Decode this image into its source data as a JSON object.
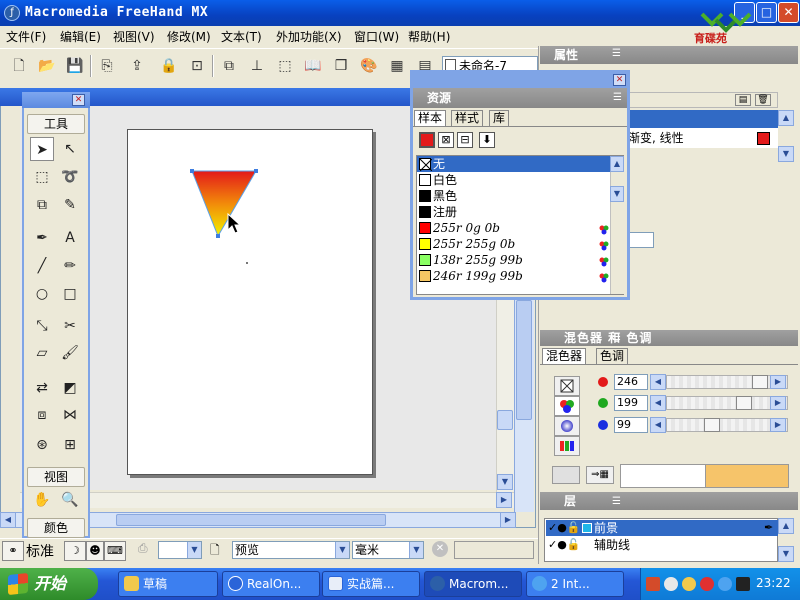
{
  "window": {
    "title": "Macromedia FreeHand MX",
    "minimize": "_",
    "maximize": "□",
    "close": "✕"
  },
  "logo": {
    "text": "育碟苑"
  },
  "menu": [
    "文件(F)",
    "编辑(E)",
    "视图(V)",
    "修改(M)",
    "文本(T)",
    "外加功能(X)",
    "窗口(W)",
    "帮助(H)"
  ],
  "toolbar": {
    "document_name": "未命名-7"
  },
  "tools_panel": {
    "header": "工具",
    "view_section": "视图",
    "color_section": "颜色"
  },
  "properties_panel": {
    "title": "属性",
    "fill_row": "渐变, 线性"
  },
  "swatches_panel": {
    "title": "资源",
    "tabs": [
      "样本",
      "样式",
      "库"
    ],
    "items": [
      {
        "label": "无",
        "color": "none"
      },
      {
        "label": "白色",
        "color": "#ffffff"
      },
      {
        "label": "黑色",
        "color": "#000000"
      },
      {
        "label": "注册",
        "color": "#000000"
      },
      {
        "label": "255r 0g 0b",
        "color": "#ff0000"
      },
      {
        "label": "255r 255g 0b",
        "color": "#ffff00"
      },
      {
        "label": "138r 255g 99b",
        "color": "#8aff63"
      },
      {
        "label": "246r 199g 99b",
        "color": "#f6c763"
      }
    ]
  },
  "mixer_panel": {
    "title": "混色器 和 色调",
    "tabs": [
      "混色器",
      "色调"
    ],
    "red": "246",
    "green": "199",
    "blue": "99",
    "preview_color": "#f6c46a"
  },
  "layers_panel": {
    "title": "层",
    "layers": [
      "前景",
      "辅助线"
    ]
  },
  "status": {
    "standard": "标准",
    "preview": "预览",
    "units": "毫米"
  },
  "taskbar": {
    "start": "开始",
    "tasks": [
      "草稿",
      "RealOn...",
      "实战篇...",
      "Macrom...",
      "2 Int..."
    ],
    "clock": "23:22"
  },
  "colors": {
    "gradient_top": "#e31a1a",
    "gradient_bottom": "#f2f200",
    "selection": "#316ac5"
  }
}
